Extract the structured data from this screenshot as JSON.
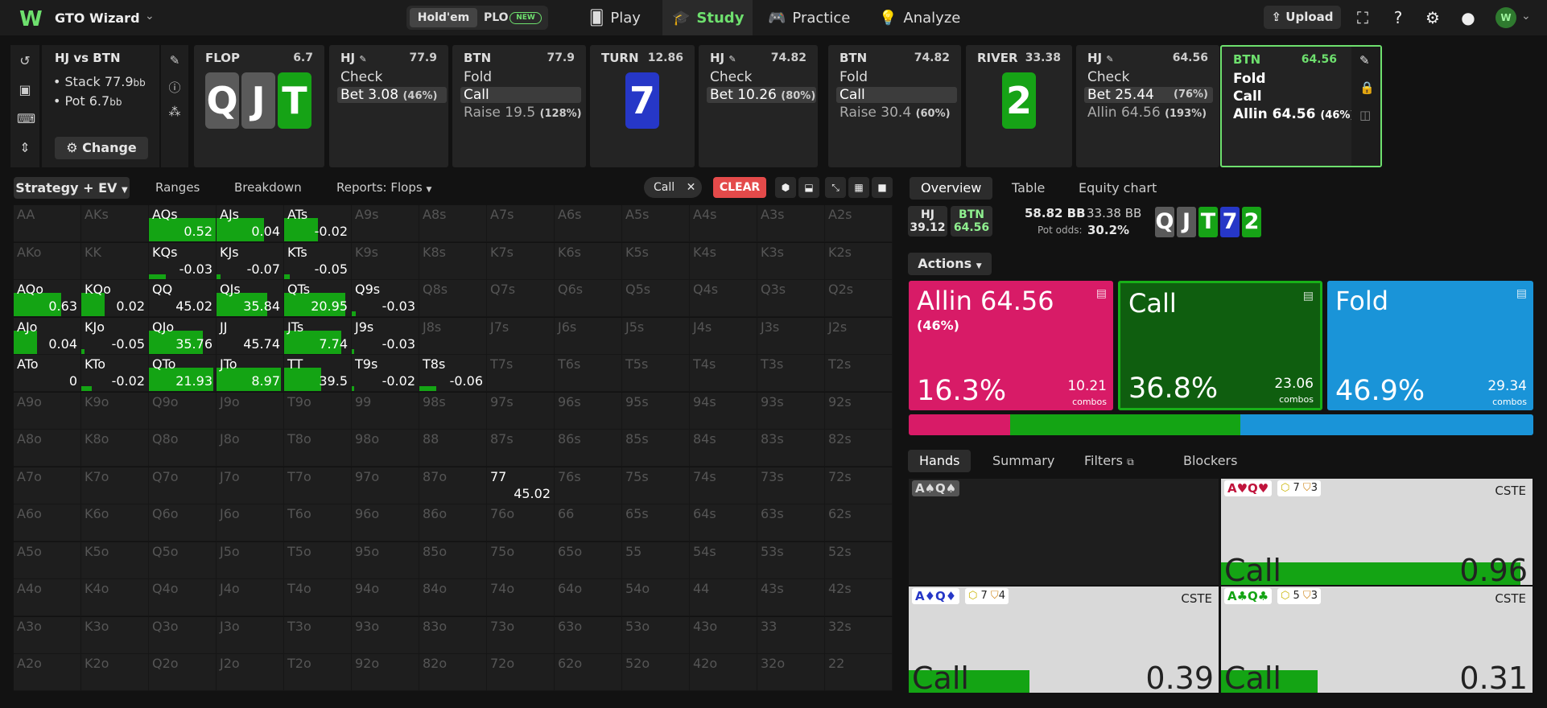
{
  "app": {
    "name": "GTO Wizard",
    "game_holdem": "Hold'em",
    "game_plo": "PLO",
    "new_badge": "NEW"
  },
  "nav": [
    {
      "label": "Play",
      "icon": "cards-icon"
    },
    {
      "label": "Study",
      "icon": "graduation-cap-icon"
    },
    {
      "label": "Practice",
      "icon": "gamepad-icon"
    },
    {
      "label": "Analyze",
      "icon": "bulb-icon"
    }
  ],
  "upload": "Upload",
  "spot": {
    "title": "HJ vs BTN",
    "stack": "• Stack 77.9",
    "pot": "• Pot 6.7",
    "unit": "bb",
    "change": "Change"
  },
  "cards": {
    "flop": {
      "label": "FLOP",
      "value": "6.7",
      "board": [
        "Q",
        "J",
        "T"
      ]
    },
    "hj1": {
      "label": "HJ",
      "value": "77.9",
      "actions": [
        "Check",
        "Bet 3.08"
      ],
      "pct": "(46%)"
    },
    "btn1": {
      "label": "BTN",
      "value": "77.9",
      "actions": [
        "Fold",
        "Call",
        "Raise 19.5"
      ],
      "pct": "(128%)"
    },
    "turn": {
      "label": "TURN",
      "value": "12.86",
      "board": "7"
    },
    "hj2": {
      "label": "HJ",
      "value": "74.82",
      "actions": [
        "Check",
        "Bet 10.26"
      ],
      "pct": "(80%)"
    },
    "btn2": {
      "label": "BTN",
      "value": "74.82",
      "actions": [
        "Fold",
        "Call",
        "Raise 30.4"
      ],
      "pct": "(60%)"
    },
    "river": {
      "label": "RIVER",
      "value": "33.38",
      "board": "2"
    },
    "hj3": {
      "label": "HJ",
      "value": "64.56",
      "actions": [
        "Check",
        "Bet 25.44",
        "Allin 64.56"
      ],
      "pcts": [
        "(76%)",
        "(193%)"
      ]
    },
    "btn3": {
      "label": "BTN",
      "value": "64.56",
      "actions": [
        "Fold",
        "Call",
        "Allin 64.56"
      ],
      "pct": "(46%)"
    }
  },
  "left_tabs": {
    "strategy": "Strategy + EV",
    "ranges": "Ranges",
    "breakdown": "Breakdown",
    "reports": "Reports: Flops",
    "filter_pill": "Call",
    "clear": "CLEAR"
  },
  "matrix": {
    "ranks": [
      "A",
      "K",
      "Q",
      "J",
      "T",
      "9",
      "8",
      "7",
      "6",
      "5",
      "4",
      "3",
      "2"
    ],
    "values": {
      "AQs": {
        "ev": "0.52",
        "bar": 1.0
      },
      "AJs": {
        "ev": "0.04",
        "bar": 0.7
      },
      "ATs": {
        "ev": "-0.02",
        "bar": 0.5
      },
      "KQs": {
        "ev": "-0.03",
        "bar": 0.25
      },
      "KJs": {
        "ev": "-0.07",
        "bar": 0.06
      },
      "KTs": {
        "ev": "-0.05",
        "bar": 0.08
      },
      "AQo": {
        "ev": "0.63",
        "bar": 0.7
      },
      "KQo": {
        "ev": "0.02",
        "bar": 0.35
      },
      "QQ": {
        "ev": "45.02",
        "bar": 0
      },
      "QJs": {
        "ev": "35.84",
        "bar": 0.75
      },
      "QTs": {
        "ev": "20.95",
        "bar": 0.9
      },
      "Q9s": {
        "ev": "-0.03",
        "bar": 0.06
      },
      "AJo": {
        "ev": "0.04",
        "bar": 0.35
      },
      "KJo": {
        "ev": "-0.05",
        "bar": 0.05
      },
      "QJo": {
        "ev": "35.76",
        "bar": 0.8
      },
      "JJ": {
        "ev": "45.74",
        "bar": 0
      },
      "JTs": {
        "ev": "7.74",
        "bar": 0.85
      },
      "J9s": {
        "ev": "-0.03",
        "bar": 0.03
      },
      "ATo": {
        "ev": "0",
        "bar": 0
      },
      "KTo": {
        "ev": "-0.02",
        "bar": 0.15
      },
      "QTo": {
        "ev": "21.93",
        "bar": 0.95
      },
      "JTo": {
        "ev": "8.97",
        "bar": 0.95
      },
      "TT": {
        "ev": "39.5",
        "bar": 0.55
      },
      "T9s": {
        "ev": "-0.02",
        "bar": 0.03
      },
      "T8s": {
        "ev": "-0.06",
        "bar": 0.25
      },
      "77": {
        "ev": "45.02",
        "bar": 0
      }
    }
  },
  "right_tabs": {
    "overview": "Overview",
    "table": "Table",
    "equity": "Equity chart"
  },
  "pot": {
    "hj_label": "HJ",
    "hj_val": "39.12",
    "btn_label": "BTN",
    "btn_val": "64.56",
    "pot_bb": "58.82 BB",
    "pot2": "33.38 BB",
    "odds_label": "Pot odds:",
    "odds_val": "30.2%",
    "board": [
      "Q",
      "J",
      "T",
      "7",
      "2"
    ]
  },
  "actions_label": "Actions",
  "actions": [
    {
      "title": "Allin 64.56",
      "sub": "(46%)",
      "pct": "16.3%",
      "combos": "10.21",
      "combos_label": "combos",
      "color": "#d81b67",
      "frac": 0.163
    },
    {
      "title": "Call",
      "sub": "",
      "pct": "36.8%",
      "combos": "23.06",
      "combos_label": "combos",
      "color": "#0f5e0f",
      "frac": 0.368
    },
    {
      "title": "Fold",
      "sub": "",
      "pct": "46.9%",
      "combos": "29.34",
      "combos_label": "combos",
      "color": "#1a94d8",
      "frac": 0.469
    }
  ],
  "bottom_tabs": {
    "hands": "Hands",
    "summary": "Summary",
    "filters": "Filters",
    "blockers": "Blockers"
  },
  "hands": [
    {
      "cards": "A♠Q♠",
      "empty": true
    },
    {
      "cards": "A♥Q♥",
      "c1": "7",
      "c2": "3",
      "cste": "CSTE",
      "action": "Call",
      "value": "0.96",
      "frac": 0.96,
      "color": "#c0143c"
    },
    {
      "cards": "A♦Q♦",
      "c1": "7",
      "c2": "4",
      "cste": "CSTE",
      "action": "Call",
      "value": "0.39",
      "frac": 0.39,
      "color": "#2637c7"
    },
    {
      "cards": "A♣Q♣",
      "c1": "5",
      "c2": "3",
      "cste": "CSTE",
      "action": "Call",
      "value": "0.31",
      "frac": 0.31,
      "color": "#14a414"
    }
  ]
}
